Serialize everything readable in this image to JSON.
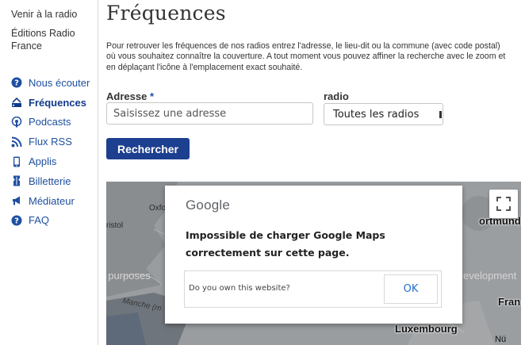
{
  "sidebar": {
    "top_links": [
      {
        "label": "Venir à la radio"
      },
      {
        "label": "Éditions Radio France"
      }
    ],
    "nav": [
      {
        "label": "Nous écouter",
        "icon": "question-icon"
      },
      {
        "label": "Fréquences",
        "icon": "antenna-icon",
        "active": true
      },
      {
        "label": "Podcasts",
        "icon": "podcast-icon"
      },
      {
        "label": "Flux RSS",
        "icon": "rss-icon"
      },
      {
        "label": "Applis",
        "icon": "phone-icon"
      },
      {
        "label": "Billetterie",
        "icon": "ticket-icon"
      },
      {
        "label": "Médiateur",
        "icon": "megaphone-icon"
      },
      {
        "label": "FAQ",
        "icon": "question-icon"
      }
    ]
  },
  "main": {
    "title": "Fréquences",
    "intro": "Pour retrouver les fréquences de nos radios entrez l'adresse, le lieu-dit ou la commune (avec code postal) où vous souhaitez connaître la couverture. A tout moment vous pouvez affiner la recherche avec le zoom et en déplaçant l'icône à l'emplacement exact souhaité.",
    "address_label": "Adresse",
    "required_mark": "*",
    "address_placeholder": "Saisissez une adresse",
    "address_value": "",
    "radio_label": "radio",
    "radio_selected": "Toutes les radios",
    "search_label": "Rechercher"
  },
  "map": {
    "watermark_left": "t purposes",
    "watermark_right": "evelopment",
    "labels": {
      "oxford": "Oxfo",
      "bristol": "ristol",
      "manche": "Manche (m",
      "luxembourg": "Luxembourg",
      "dortmund": "ortmund",
      "fr": "Fran",
      "nu": "Nü"
    },
    "dialog": {
      "logo": "Google",
      "message": "Impossible de charger Google Maps correctement sur cette page.",
      "own_question": "Do you own this website?",
      "ok_label": "OK"
    }
  },
  "colors": {
    "link": "#1f4fa0",
    "button": "#1d3f8f",
    "ok_text": "#1f6fd0",
    "map_bg": "#8b8f93"
  }
}
